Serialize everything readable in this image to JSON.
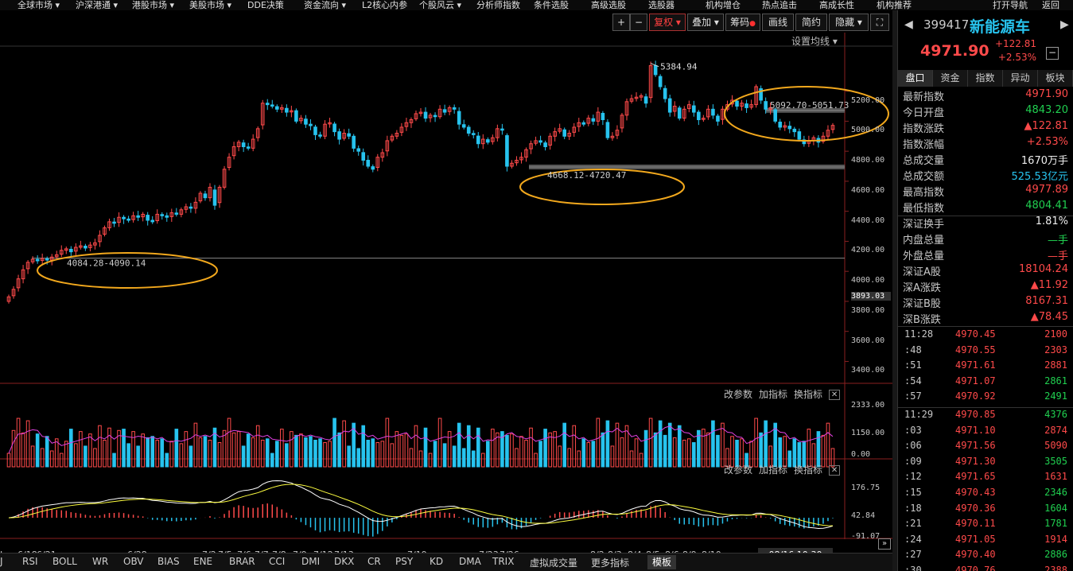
{
  "menu": [
    "全球市场 ▾",
    "沪深港通 ▾",
    "港股市场 ▾",
    "美股市场 ▾",
    "DDE决策",
    "资金流向 ▾",
    "L2核心内参",
    "个股风云 ▾",
    "分析师指数",
    "条件选股",
    "高级选股",
    "选股器",
    "机构增仓",
    "热点追击",
    "高成长性",
    "机构推荐",
    "打开导航",
    "返回"
  ],
  "toolbar": {
    "plus": "+",
    "minus": "−",
    "fuquan": "复权 ▾",
    "diejia": "叠加 ▾",
    "chouma": "筹码",
    "huaxian": "画线",
    "jianyue": "简约",
    "yincang": "隐藏 ▾",
    "expand": "⛶"
  },
  "set_ma": "设置均线 ▾",
  "annotations": {
    "peak": "5384.94",
    "range1": "4084.28-4090.14",
    "range2": "4668.12-4720.47",
    "range3": "5092.70-5051.73"
  },
  "price_badge": "3893.03",
  "pane_links": {
    "params": "改参数",
    "add": "加指标",
    "swap": "换指标",
    "close": "✕"
  },
  "colors": {
    "up": "#ff4a4a",
    "down": "#27c3ee",
    "ellipse": "#f2a81d",
    "ma_white": "#ffffff",
    "ma_yellow": "#ffff40",
    "ma_purple": "#e040e0"
  },
  "chart_data": {
    "type": "candlestick",
    "title": "",
    "price_axis": {
      "ticks": [
        5200,
        5000,
        4800,
        4600,
        4400,
        4200,
        4000,
        3800,
        3600,
        3400
      ],
      "labels": [
        "5200.00",
        "5000.00",
        "4800.00",
        "4600.00",
        "4400.00",
        "4200.00",
        "4000.00",
        "3800.00",
        "3600.00",
        "3400.00"
      ],
      "range": [
        3270,
        5500
      ]
    },
    "volume_axis": {
      "labels": [
        "2333.00",
        "1150.00",
        "0.00"
      ],
      "range": [
        0,
        2333
      ]
    },
    "macd_axis": {
      "labels": [
        "176.75",
        "42.84",
        "-91.07"
      ],
      "range": [
        -100,
        180
      ]
    },
    "x_labels": [
      "J",
      "6/18",
      "6/21",
      "6/28",
      "7/2",
      "7/5",
      "7/6",
      "7/7",
      "7/8",
      "7/9",
      "7/12",
      "7/13",
      "7/19",
      "7/23",
      "7/26",
      "8/2",
      "8/3",
      "8/4",
      "8/5",
      "8/6",
      "8/9",
      "8/10"
    ],
    "cursor_date": "08/16,10:30",
    "support_lines": [
      4088,
      4695,
      5072
    ],
    "peak_value": 5384.94,
    "closes": [
      3830,
      3880,
      3950,
      4010,
      4060,
      4080,
      4070,
      4085,
      4075,
      4095,
      4110,
      4140,
      4150,
      4130,
      4160,
      4170,
      4155,
      4175,
      4190,
      4240,
      4290,
      4330,
      4320,
      4360,
      4350,
      4340,
      4370,
      4360,
      4380,
      4340,
      4330,
      4380,
      4370,
      4360,
      4390,
      4380,
      4410,
      4430,
      4420,
      4460,
      4520,
      4490,
      4560,
      4440,
      4560,
      4680,
      4760,
      4830,
      4860,
      4830,
      4820,
      4880,
      4950,
      5120,
      5110,
      5100,
      5080,
      5090,
      5060,
      5070,
      5000,
      5020,
      4980,
      4970,
      4910,
      4900,
      4980,
      4990,
      4930,
      4880,
      4920,
      4900,
      4820,
      4800,
      4740,
      4700,
      4680,
      4760,
      4790,
      4870,
      4900,
      4920,
      4960,
      4990,
      5010,
      5050,
      5060,
      5020,
      5040,
      5030,
      5080,
      5060,
      5090,
      5080,
      4980,
      4960,
      4920,
      4910,
      4850,
      4880,
      4860,
      4890,
      4950,
      4940,
      4700,
      4720,
      4740,
      4760,
      4810,
      4850,
      4870,
      4860,
      4830,
      4900,
      4930,
      4950,
      4900,
      4920,
      4960,
      4990,
      4980,
      5020,
      5000,
      5060,
      5010,
      4890,
      4900,
      4940,
      5040,
      5130,
      5150,
      5160,
      5170,
      5120,
      5370,
      5310,
      5230,
      5150,
      5060,
      5100,
      5020,
      5080,
      5110,
      5060,
      5010,
      5020,
      5080,
      5040,
      5000,
      5080,
      5110,
      5140,
      5100,
      5120,
      5090,
      5110,
      5230,
      5140,
      5080,
      5090,
      5000,
      4960,
      4970,
      4950,
      4930,
      4880,
      4850,
      4870,
      4890,
      4860,
      4900,
      4940,
      4972
    ]
  },
  "right": {
    "code": "399417",
    "name": "新能源车",
    "price": "4971.90",
    "change": "+122.81",
    "change_pct": "+2.53%",
    "tabs": [
      "盘口",
      "资金",
      "指数",
      "异动",
      "板块"
    ],
    "quote": [
      {
        "k": "最新指数",
        "v": "4971.90",
        "c": "red"
      },
      {
        "k": "今日开盘",
        "v": "4843.20",
        "c": "green"
      },
      {
        "k": "指数涨跌",
        "v": "▲122.81",
        "c": "red"
      },
      {
        "k": "指数涨幅",
        "v": "+2.53%",
        "c": "red"
      },
      {
        "k": "总成交量",
        "v": "1670万手",
        "c": "white"
      },
      {
        "k": "总成交额",
        "v": "525.53亿元",
        "c": "cyan"
      },
      {
        "k": "最高指数",
        "v": "4977.89",
        "c": "red"
      },
      {
        "k": "最低指数",
        "v": "4804.41",
        "c": "green"
      }
    ],
    "quote2": [
      {
        "k": "深证换手",
        "v": "1.81%",
        "c": "white"
      },
      {
        "k": "内盘总量",
        "v": "—手",
        "c": "green"
      },
      {
        "k": "外盘总量",
        "v": "—手",
        "c": "red"
      },
      {
        "k": "深证A股",
        "v": "18104.24",
        "c": "red"
      },
      {
        "k": "深A涨跌",
        "v": "▲11.92",
        "c": "red"
      },
      {
        "k": "深证B股",
        "v": "8167.31",
        "c": "red"
      },
      {
        "k": "深B涨跌",
        "v": "▲78.45",
        "c": "red"
      }
    ],
    "ticks": [
      {
        "t": "11:28",
        "p": "4970.45",
        "q": "2100",
        "c": "red"
      },
      {
        "t": ":48",
        "p": "4970.55",
        "q": "2303",
        "c": "red"
      },
      {
        "t": ":51",
        "p": "4971.61",
        "q": "2881",
        "c": "red"
      },
      {
        "t": ":54",
        "p": "4971.07",
        "q": "2861",
        "c": "green"
      },
      {
        "t": ":57",
        "p": "4970.92",
        "q": "2491",
        "c": "green"
      },
      {
        "t": "11:29",
        "p": "4970.85",
        "q": "4376",
        "c": "green"
      },
      {
        "t": ":03",
        "p": "4971.10",
        "q": "2874",
        "c": "red"
      },
      {
        "t": ":06",
        "p": "4971.56",
        "q": "5090",
        "c": "red"
      },
      {
        "t": ":09",
        "p": "4971.30",
        "q": "3505",
        "c": "green"
      },
      {
        "t": ":12",
        "p": "4971.65",
        "q": "1631",
        "c": "red"
      },
      {
        "t": ":15",
        "p": "4970.43",
        "q": "2346",
        "c": "green"
      },
      {
        "t": ":18",
        "p": "4970.36",
        "q": "1604",
        "c": "green"
      },
      {
        "t": ":21",
        "p": "4970.11",
        "q": "1781",
        "c": "green"
      },
      {
        "t": ":24",
        "p": "4971.05",
        "q": "1914",
        "c": "red"
      },
      {
        "t": ":27",
        "p": "4970.40",
        "q": "2886",
        "c": "green"
      },
      {
        "t": ":30",
        "p": "4970.76",
        "q": "2388",
        "c": "red"
      }
    ]
  },
  "bottom_tabs": [
    "J",
    "RSI",
    "BOLL",
    "WR",
    "OBV",
    "BIAS",
    "ENE",
    "BRAR",
    "CCI",
    "DMI",
    "DKX",
    "CR",
    "PSY",
    "KD",
    "DMA",
    "TRIX",
    "虚拟成交量",
    "更多指标",
    "模板"
  ]
}
